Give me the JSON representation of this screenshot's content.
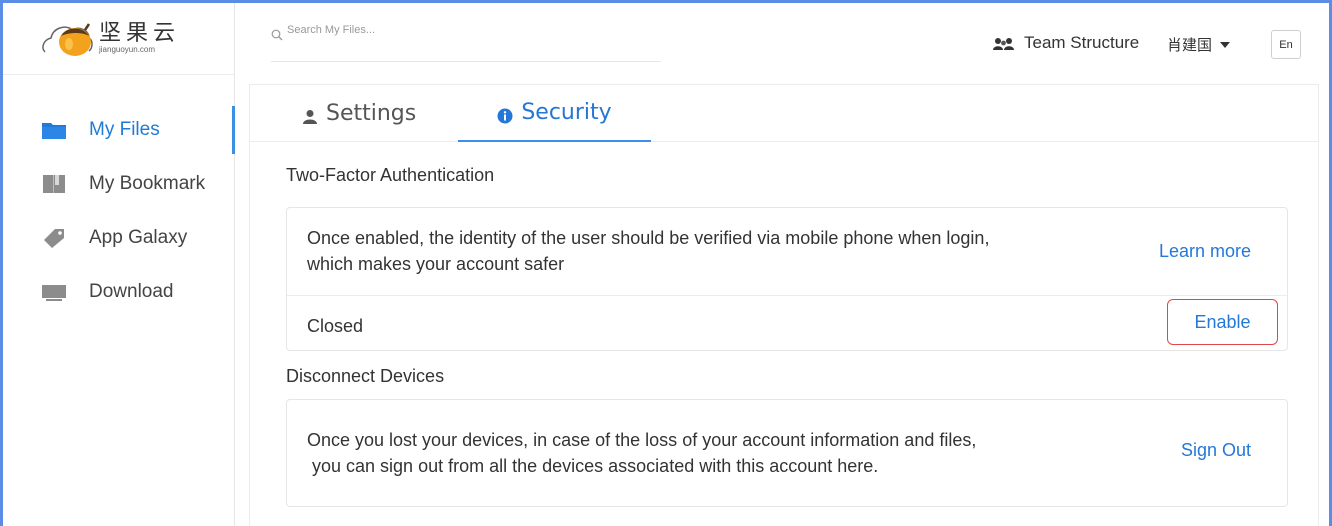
{
  "app": {
    "logo_cn": "坚果云",
    "logo_en": "jianguoyun.com"
  },
  "sidebar": {
    "items": [
      {
        "label": "My Files",
        "icon": "folder-icon",
        "active": true
      },
      {
        "label": "My Bookmark",
        "icon": "bookmark-icon",
        "active": false
      },
      {
        "label": "App Galaxy",
        "icon": "tag-icon",
        "active": false
      },
      {
        "label": "Download",
        "icon": "monitor-icon",
        "active": false
      }
    ]
  },
  "header": {
    "search_placeholder": "Search My Files...",
    "team_label": "Team Structure",
    "user_name": "肖建国",
    "lang_label": "En"
  },
  "tabs": [
    {
      "label": "Settings",
      "icon": "user-icon",
      "active": false
    },
    {
      "label": "Security",
      "icon": "info-icon",
      "active": true
    }
  ],
  "two_factor": {
    "title": "Two-Factor Authentication",
    "description_line1": "Once enabled, the identity of the user should be verified via mobile phone when login,",
    "description_line2": "which makes your account safer",
    "learn_more": "Learn more",
    "status": "Closed",
    "enable_label": "Enable"
  },
  "disconnect": {
    "title": "Disconnect Devices",
    "description_line1": "Once you lost your devices, in case of the loss of your account information and files,",
    "description_line2": " you can sign out from all the devices associated with this account here.",
    "sign_out": "Sign Out"
  },
  "colors": {
    "accent": "#2478d8",
    "active_tab": "#3a8fe6",
    "enable_border": "#e0474b",
    "frame": "#5b8ce6"
  }
}
